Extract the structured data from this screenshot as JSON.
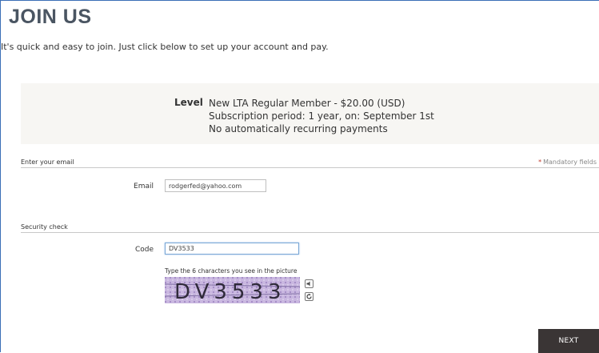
{
  "page": {
    "title": "JOIN US",
    "intro": "It's quick and easy to join.  Just click below to set up your account and pay."
  },
  "level": {
    "label": "Level",
    "lines": [
      "New LTA Regular Member - $20.00 (USD)",
      "Subscription period: 1 year, on: September 1st",
      "No automatically recurring payments"
    ]
  },
  "email_section": {
    "heading": "Enter your email",
    "mandatory_star": "*",
    "mandatory_label": "Mandatory fields",
    "field_label": "Email",
    "field_value": "rodgerfed@yahoo.com"
  },
  "security_section": {
    "heading": "Security check",
    "field_label": "Code",
    "field_value": "DV3533",
    "hint": "Type the 6 characters you see in the picture",
    "captcha_text": "DV3533",
    "icons": [
      "audio-icon",
      "refresh-icon"
    ]
  },
  "actions": {
    "next_label": "NEXT"
  },
  "colors": {
    "title": "#4a5562",
    "level_bg": "#f7f6f3",
    "next_bg": "#3a3535",
    "mandatory_star": "#c0392b",
    "captcha_bg": "#b7a3d2"
  }
}
